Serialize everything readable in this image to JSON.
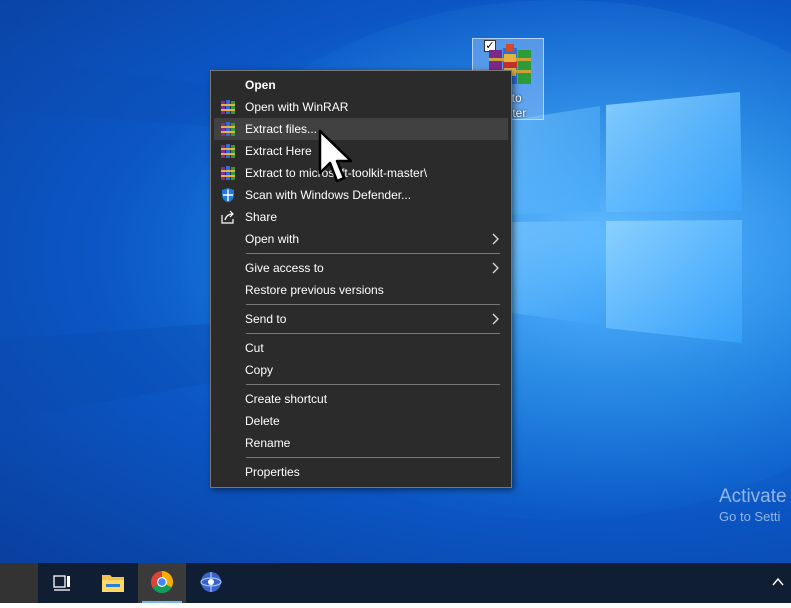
{
  "desktop": {
    "icon": {
      "label_line1": "oft-to",
      "label_line2": "master"
    },
    "watermark": {
      "line1": "Activate",
      "line2": "Go to Setti"
    }
  },
  "context_menu": {
    "groups": [
      [
        {
          "label": "Open",
          "bold": true,
          "icon": "none"
        },
        {
          "label": "Open with WinRAR",
          "icon": "winrar-icon"
        },
        {
          "label": "Extract files...",
          "icon": "winrar-icon",
          "highlighted": true
        },
        {
          "label": "Extract Here",
          "icon": "winrar-icon"
        },
        {
          "label": "Extract to microsoft-toolkit-master\\",
          "icon": "winrar-icon"
        },
        {
          "label": "Scan with Windows Defender...",
          "icon": "defender-shield-icon"
        },
        {
          "label": "Share",
          "icon": "share-icon"
        },
        {
          "label": "Open with",
          "icon": "none",
          "submenu": true
        }
      ],
      [
        {
          "label": "Give access to",
          "submenu": true
        },
        {
          "label": "Restore previous versions"
        }
      ],
      [
        {
          "label": "Send to",
          "submenu": true
        }
      ],
      [
        {
          "label": "Cut"
        },
        {
          "label": "Copy"
        }
      ],
      [
        {
          "label": "Create shortcut"
        },
        {
          "label": "Delete"
        },
        {
          "label": "Rename"
        }
      ],
      [
        {
          "label": "Properties"
        }
      ]
    ]
  },
  "taskbar": {
    "items": [
      "task-view-icon",
      "file-explorer-icon",
      "chrome-icon",
      "app-globe-icon"
    ],
    "tray": "show-hidden-icons-chevron-icon"
  },
  "colors": {
    "menu_bg": "#2b2b2b",
    "menu_highlight": "#414141",
    "taskbar_bg": "#0f1e33",
    "desktop_accent": "#1a7fe0"
  }
}
